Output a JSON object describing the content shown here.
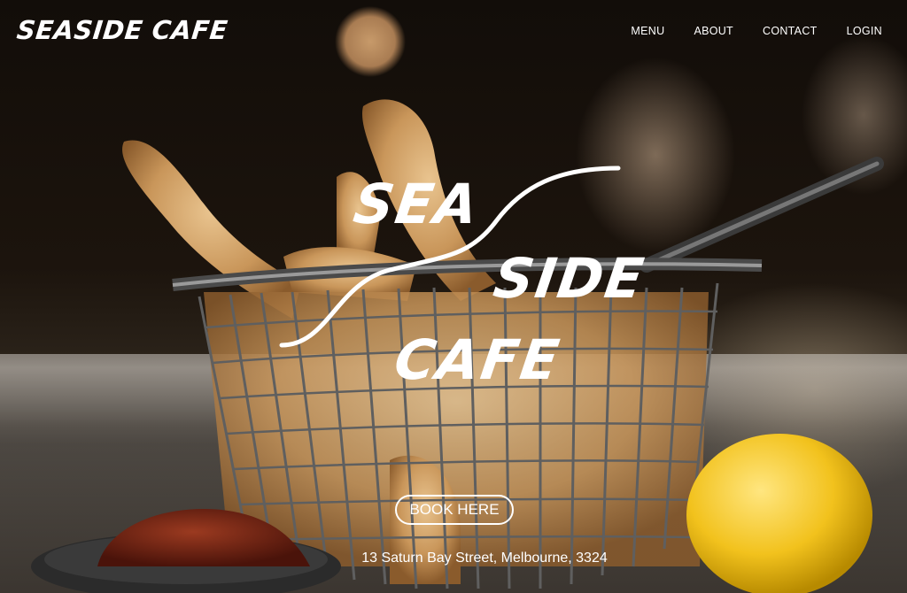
{
  "brand": {
    "name": "SEASIDE CAFE"
  },
  "nav": {
    "items": [
      "MENU",
      "ABOUT",
      "CONTACT",
      "LOGIN"
    ]
  },
  "hero": {
    "logo_lines": [
      "SEA",
      "SIDE",
      "CAFE"
    ],
    "cta_label": "BOOK HERE",
    "address": "13 Saturn Bay Street, Melbourne, 3324"
  },
  "colors": {
    "text": "#ffffff",
    "background": "#0e0b08"
  }
}
